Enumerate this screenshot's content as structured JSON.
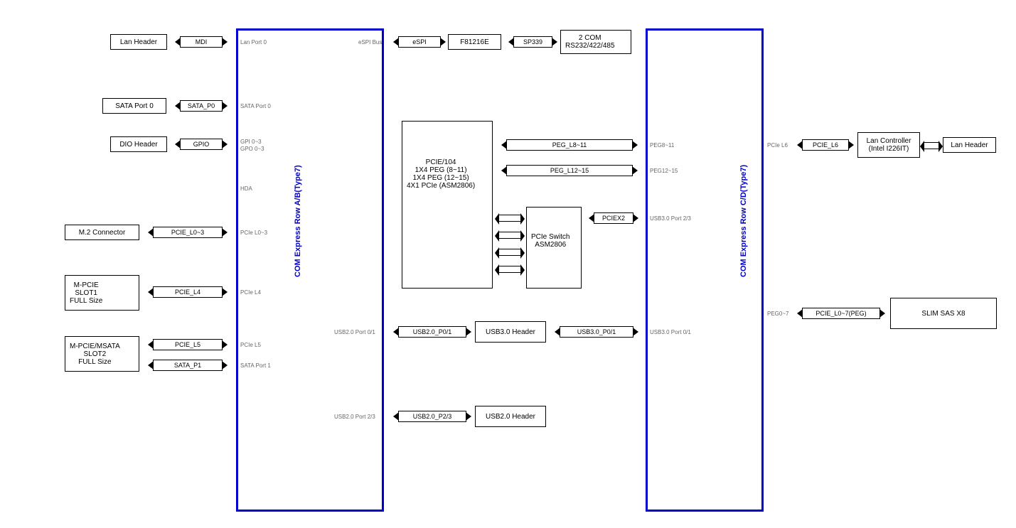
{
  "row_ab": {
    "label": "COM Express Row A/B(Type7)"
  },
  "row_cd": {
    "label": "COM Express Row C/D(Type7)"
  },
  "left": {
    "lan_header": "Lan Header",
    "mdi": "MDI",
    "sata_port0": "SATA Port 0",
    "sata_p0": "SATA_P0",
    "dio_header": "DIO Header",
    "gpio": "GPIO",
    "m2": "M.2 Connector",
    "pcie_l0_3": "PCIE_L0~3",
    "mpcie1": "M-PCIE\nSLOT1\nFULL Size",
    "pcie_l4": "PCIE_L4",
    "mpcie2": "M-PCIE/MSATA\nSLOT2\nFULL Size",
    "pcie_l5": "PCIE_L5",
    "sata_p1": "SATA_P1"
  },
  "ab_pins": {
    "lan": "Lan Port 0",
    "sata0": "SATA Port 0",
    "gpi": "GPI 0~3",
    "gpo": "GPO 0~3",
    "hda": "HDA",
    "pcie_l0_3": "PCIe L0~3",
    "pcie_l4": "PCIe L4",
    "pcie_l5": "PCIe L5",
    "sata1": "SATA Port 1",
    "espi": "eSPI Bus",
    "usb20_01": "USB2.0 Port 0/1",
    "usb20_23": "USB2.0 Port 2/3"
  },
  "middle": {
    "espi": "eSPI",
    "f81216e": "F81216E",
    "sp339": "SP339",
    "com2": "2 COM\nRS232/422/485",
    "pcie104": "PCIE/104\n1X4 PEG (8~11)\n1X4 PEG (12~15)\n4X1 PCIe (ASM2806)",
    "peg_l8_11": "PEG_L8~11",
    "peg_l12_15": "PEG_L12~15",
    "pciex2": "PCIEX2",
    "pcie_switch": "PCIe Switch\nASM2806",
    "usb20_p01": "USB2.0_P0/1",
    "usb30_header": "USB3.0 Header",
    "usb30_p01": "USB3.0_P0/1",
    "usb20_p23": "USB2.0_P2/3",
    "usb20_header": "USB2.0 Header"
  },
  "cd_pins": {
    "peg8_11": "PEG8~11",
    "peg12_15": "PEG12~15",
    "usb30_23": "USB3.0 Port 2/3",
    "usb30_01": "USB3.0 Port 0/1",
    "pcie_l6": "PCIe L6",
    "peg0_7": "PEG0~7"
  },
  "right": {
    "pcie_l6": "PCIE_L6",
    "lan_ctrl": "Lan Controller\n(Intel I226IT)",
    "lan_header": "Lan Header",
    "pcie_l0_7": "PCIE_L0~7(PEG)",
    "slim_sas": "SLIM SAS X8"
  }
}
